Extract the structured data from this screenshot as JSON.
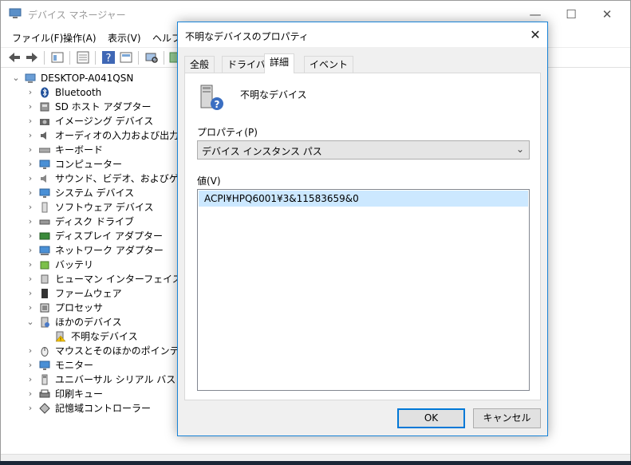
{
  "main_window": {
    "title": "デバイス マネージャー",
    "controls": {
      "minimize": "—",
      "maximize": "☐",
      "close": "✕"
    },
    "menu": [
      "ファイル(F)",
      "操作(A)",
      "表示(V)",
      "ヘルプ(H)"
    ]
  },
  "tree": {
    "root": "DESKTOP-A041QSN",
    "items": [
      {
        "label": "Bluetooth",
        "icon": "bluetooth-icon"
      },
      {
        "label": "SD ホスト アダプター",
        "icon": "sd-host-icon"
      },
      {
        "label": "イメージング デバイス",
        "icon": "camera-icon"
      },
      {
        "label": "オーディオの入力および出力",
        "icon": "speaker-icon"
      },
      {
        "label": "キーボード",
        "icon": "keyboard-icon"
      },
      {
        "label": "コンピューター",
        "icon": "monitor-icon"
      },
      {
        "label": "サウンド、ビデオ、およびゲーム コントローラー",
        "icon": "sound-icon"
      },
      {
        "label": "システム デバイス",
        "icon": "system-device-icon"
      },
      {
        "label": "ソフトウェア デバイス",
        "icon": "software-device-icon"
      },
      {
        "label": "ディスク ドライブ",
        "icon": "disk-drive-icon"
      },
      {
        "label": "ディスプレイ アダプター",
        "icon": "display-adapter-icon"
      },
      {
        "label": "ネットワーク アダプター",
        "icon": "network-adapter-icon"
      },
      {
        "label": "バッテリ",
        "icon": "battery-icon"
      },
      {
        "label": "ヒューマン インターフェイス デバイス",
        "icon": "hid-icon"
      },
      {
        "label": "ファームウェア",
        "icon": "firmware-icon"
      },
      {
        "label": "プロセッサ",
        "icon": "processor-icon"
      },
      {
        "label": "ほかのデバイス",
        "icon": "other-devices-icon"
      },
      {
        "label": "不明なデバイス",
        "icon": "unknown-device-warning-icon"
      },
      {
        "label": "マウスとそのほかのポインティング デバイス",
        "icon": "mouse-icon"
      },
      {
        "label": "モニター",
        "icon": "monitor-icon"
      },
      {
        "label": "ユニバーサル シリアル バス コントローラー",
        "icon": "usb-icon"
      },
      {
        "label": "印刷キュー",
        "icon": "printer-icon"
      },
      {
        "label": "記憶域コントローラー",
        "icon": "storage-controller-icon"
      }
    ]
  },
  "dialog": {
    "title": "不明なデバイスのプロパティ",
    "close": "✕",
    "tabs": [
      "全般",
      "ドライバー",
      "詳細",
      "イベント"
    ],
    "active_tab": "詳細",
    "device_name": "不明なデバイス",
    "property_label": "プロパティ(P)",
    "property_value": "デバイス インスタンス パス",
    "value_label": "値(V)",
    "value_text": "ACPI¥HPQ6001¥3&11583659&0",
    "ok": "OK",
    "cancel": "キャンセル"
  },
  "colors": {
    "accent": "#0078d7",
    "selection": "#cce8ff",
    "dialog_bg": "#f0f0f0"
  }
}
